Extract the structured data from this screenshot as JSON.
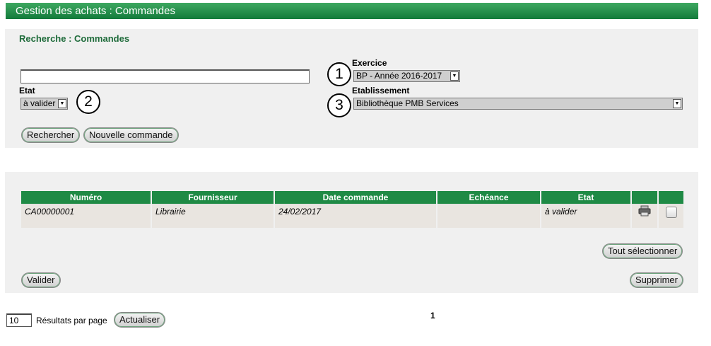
{
  "header": {
    "title": "Gestion des achats : Commandes"
  },
  "search": {
    "title": "Recherche : Commandes",
    "text_value": "",
    "etat_label": "Etat",
    "etat_value": "à valider",
    "exercice_label": "Exercice",
    "exercice_value": "BP - Année 2016-2017",
    "etablissement_label": "Etablissement",
    "etablissement_value": "Bibliothèque PMB Services",
    "search_button": "Rechercher",
    "new_button": "Nouvelle commande"
  },
  "annotations": [
    "1",
    "2",
    "3"
  ],
  "table": {
    "headers": [
      "Numéro",
      "Fournisseur",
      "Date commande",
      "Echéance",
      "Etat",
      "",
      ""
    ],
    "rows": [
      {
        "numero": "CA00000001",
        "fournisseur": "Librairie",
        "date": "24/02/2017",
        "echeance": "",
        "etat": "à valider"
      }
    ]
  },
  "actions": {
    "select_all": "Tout sélectionner",
    "validate": "Valider",
    "delete": "Supprimer"
  },
  "pagination": {
    "per_page_value": "10",
    "per_page_label": "Résultats par page",
    "refresh_button": "Actualiser",
    "current_page": "1"
  },
  "icons": {
    "print": "printer-icon",
    "select": "checkbox"
  },
  "colors": {
    "accent": "#1f8a45",
    "title_text": "#1e6b3a"
  }
}
